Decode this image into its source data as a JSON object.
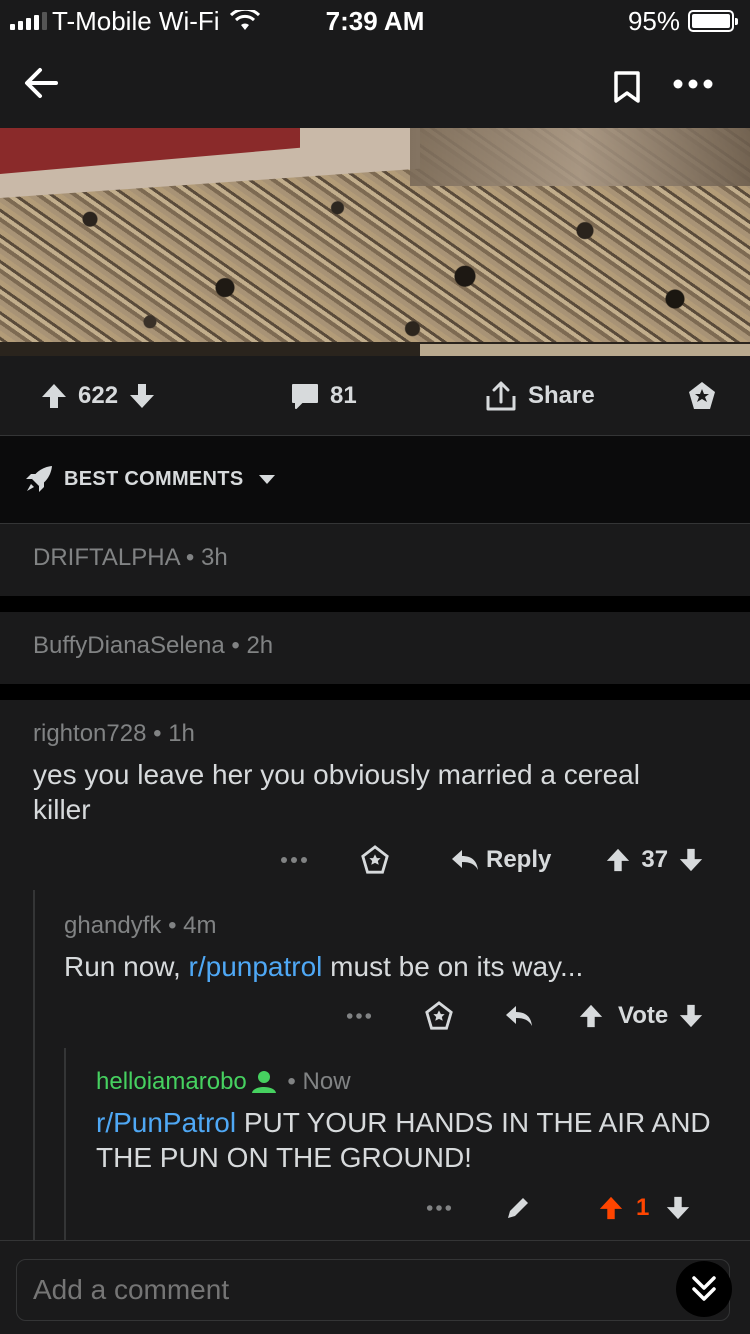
{
  "status": {
    "carrier": "T-Mobile Wi-Fi",
    "time": "7:39 AM",
    "battery": "95%"
  },
  "nav": {
    "back_icon": "back-arrow-icon",
    "bookmark_icon": "bookmark-icon",
    "more_icon": "more-icon"
  },
  "post": {
    "upvotes": "622",
    "comments": "81",
    "share_label": "Share"
  },
  "sort": {
    "label": "BEST COMMENTS"
  },
  "comments": [
    {
      "author": "DRIFTALPHA",
      "age": "3h"
    },
    {
      "author": "BuffyDianaSelena",
      "age": "2h"
    },
    {
      "author": "righton728",
      "age": "1h",
      "body": "yes you leave her you obviously married a cereal killer",
      "reply_label": "Reply",
      "score": "37"
    },
    {
      "author": "ghandyfk",
      "age": "4m",
      "body_prefix": "Run now, ",
      "body_link": "r/punpatrol",
      "body_suffix": " must be on its way...",
      "vote_label": "Vote"
    },
    {
      "author": "helloiamarobo",
      "age": "Now",
      "body_link": "r/PunPatrol",
      "body_text": " PUT YOUR HANDS IN THE AIR AND THE PUN ON THE GROUND!",
      "score": "1"
    }
  ],
  "compose": {
    "placeholder": "Add a comment"
  },
  "colors": {
    "background": "#1a1a1b",
    "link": "#4fa8f5",
    "upvote_active": "#ff4500",
    "op_green": "#46d160"
  }
}
